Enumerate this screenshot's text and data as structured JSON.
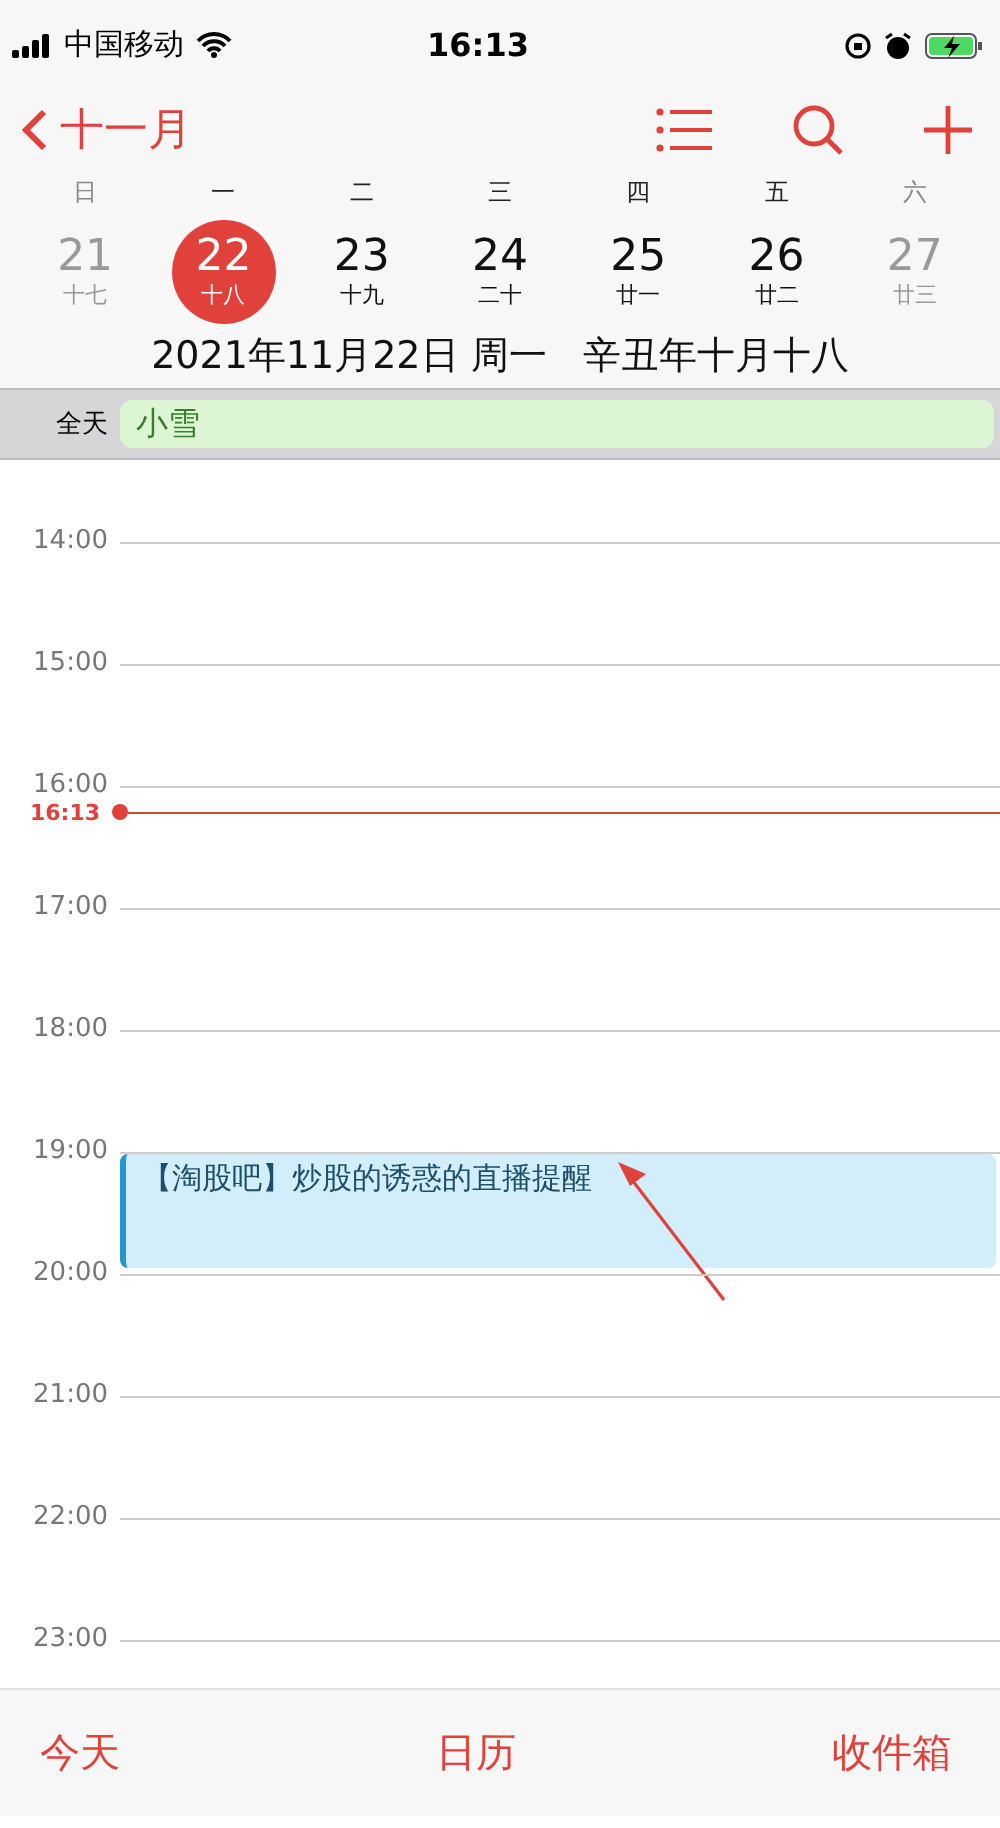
{
  "status_bar": {
    "carrier": "中国移动",
    "time": "16:13"
  },
  "nav": {
    "back_label": "十一月"
  },
  "week": [
    {
      "weekday": "日",
      "date": "21",
      "lunar": "十七",
      "selected": false,
      "weekend": true
    },
    {
      "weekday": "一",
      "date": "22",
      "lunar": "十八",
      "selected": true,
      "weekend": false
    },
    {
      "weekday": "二",
      "date": "23",
      "lunar": "十九",
      "selected": false,
      "weekend": false
    },
    {
      "weekday": "三",
      "date": "24",
      "lunar": "二十",
      "selected": false,
      "weekend": false
    },
    {
      "weekday": "四",
      "date": "25",
      "lunar": "廿一",
      "selected": false,
      "weekend": false
    },
    {
      "weekday": "五",
      "date": "26",
      "lunar": "廿二",
      "selected": false,
      "weekend": false
    },
    {
      "weekday": "六",
      "date": "27",
      "lunar": "廿三",
      "selected": false,
      "weekend": true
    }
  ],
  "date_line": "2021年11月22日 周一   辛丑年十月十八",
  "all_day": {
    "label": "全天",
    "event": "小雪"
  },
  "hours": [
    {
      "label": "14:00"
    },
    {
      "label": "15:00"
    },
    {
      "label": "16:00",
      "now": "16:13"
    },
    {
      "label": "17:00"
    },
    {
      "label": "18:00"
    },
    {
      "label": "19:00",
      "events": [
        {
          "title": "【淘股吧】炒股的诱惑的直播提醒"
        }
      ]
    },
    {
      "label": "20:00"
    },
    {
      "label": "21:00"
    },
    {
      "label": "22:00"
    },
    {
      "label": "23:00"
    }
  ],
  "tab_bar": [
    "今天",
    "日历",
    "收件箱"
  ]
}
